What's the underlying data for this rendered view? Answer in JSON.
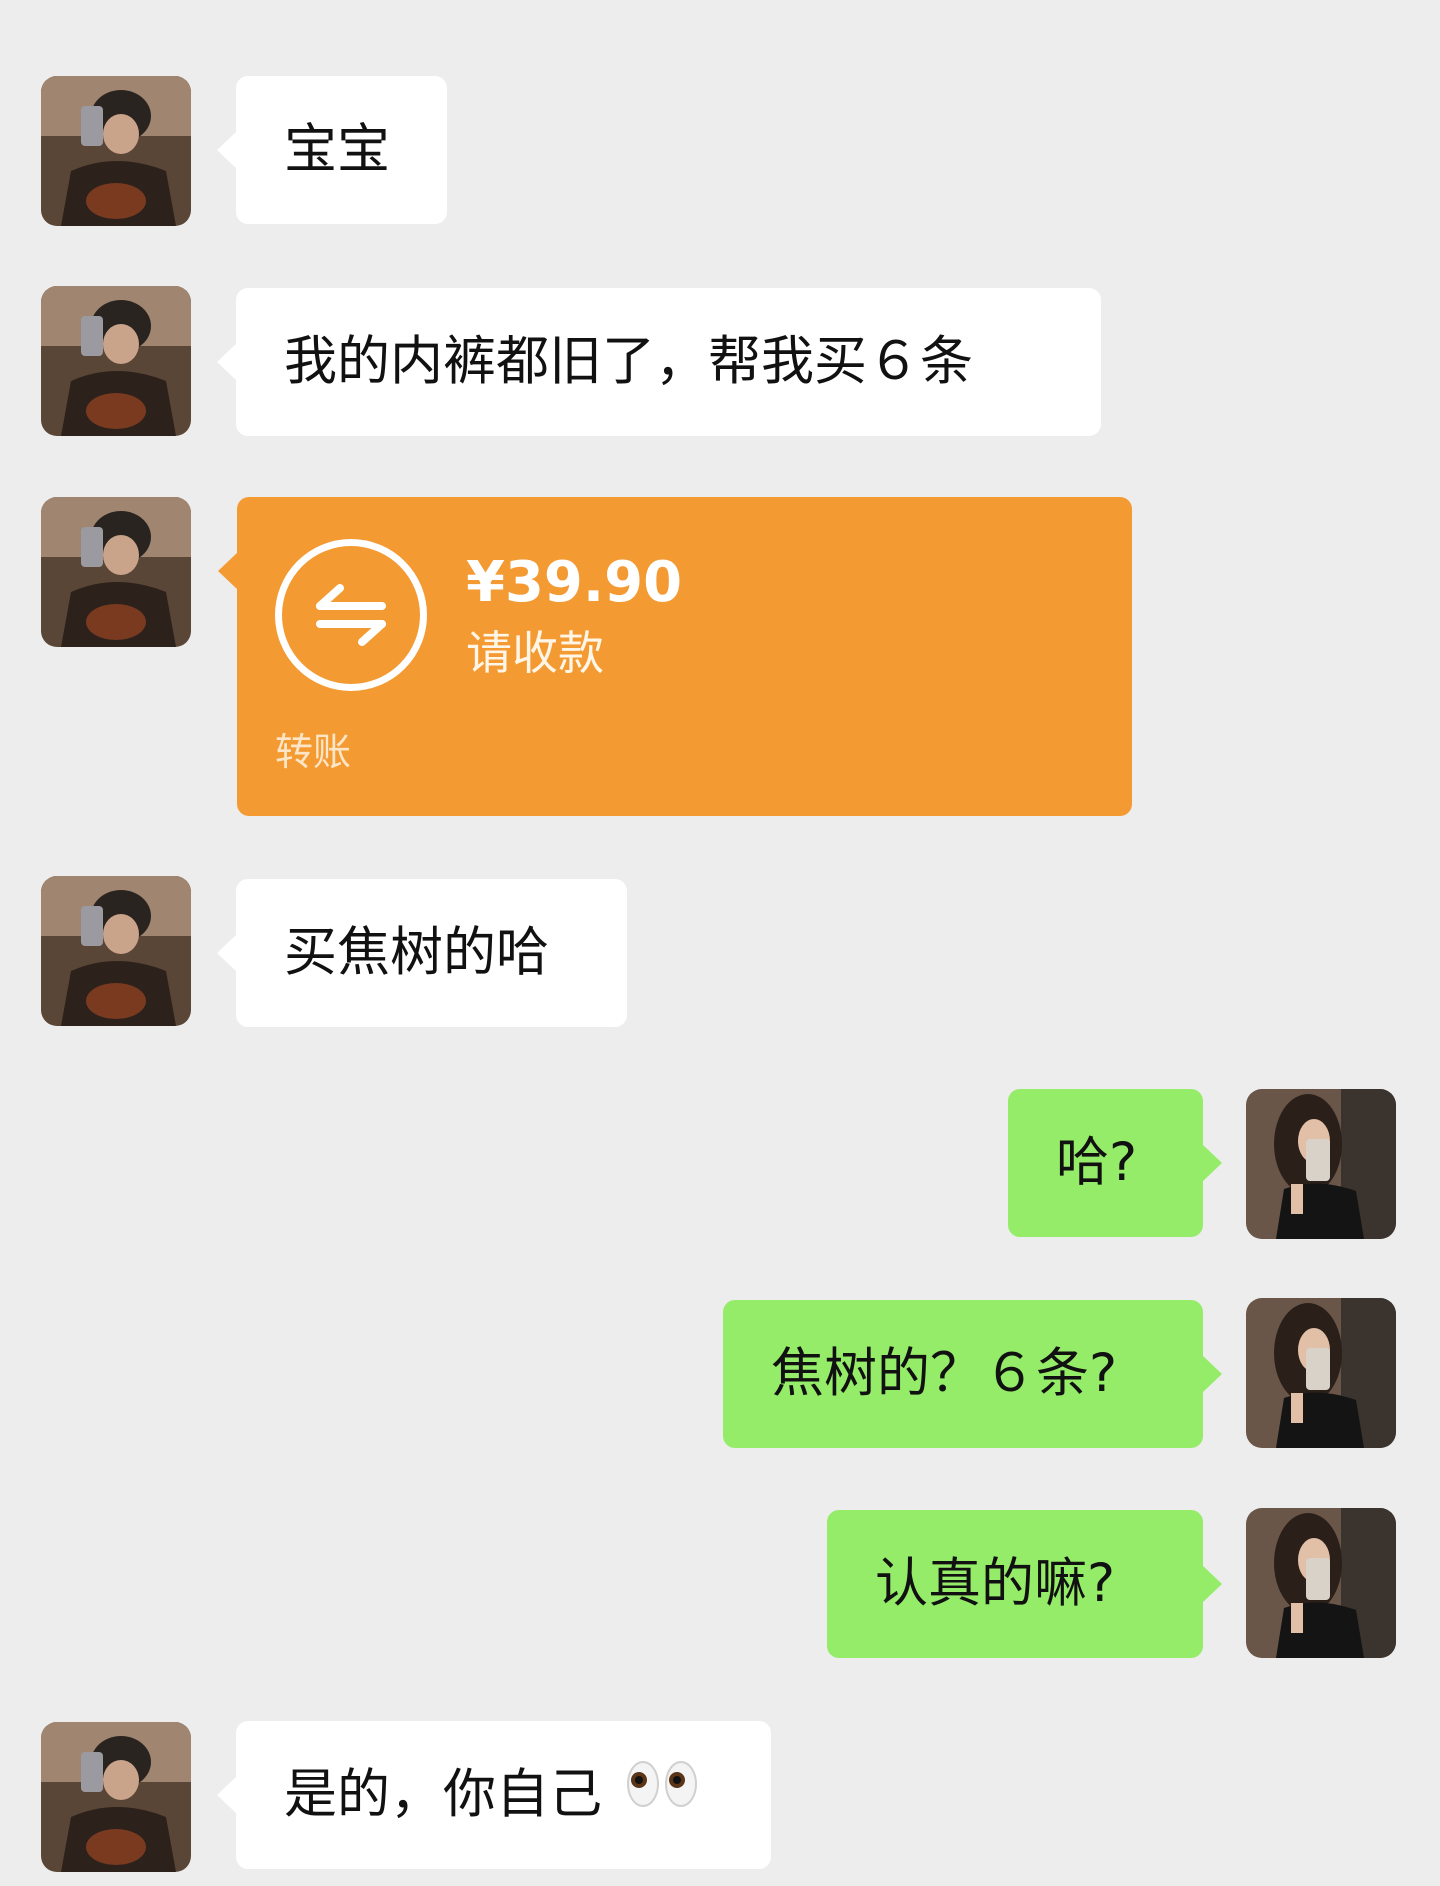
{
  "messages": [
    {
      "from": "them",
      "type": "text",
      "text": "宝宝"
    },
    {
      "from": "them",
      "type": "text",
      "text": "我的内裤都旧了，帮我买６条"
    },
    {
      "from": "them",
      "type": "transfer",
      "amount": "¥39.90",
      "note": "请收款",
      "label": "转账"
    },
    {
      "from": "them",
      "type": "text",
      "text": "买焦树的哈"
    },
    {
      "from": "me",
      "type": "text",
      "text": "哈?"
    },
    {
      "from": "me",
      "type": "text",
      "text": "焦树的？６条?"
    },
    {
      "from": "me",
      "type": "text",
      "text": "认真的嘛?"
    },
    {
      "from": "them",
      "type": "text",
      "text": "是的，你自己",
      "emoji": "eyes-emoji"
    }
  ],
  "colors": {
    "background": "#ededed",
    "incoming_bubble": "#ffffff",
    "outgoing_bubble": "#95ec69",
    "transfer_bubble": "#f49a32"
  }
}
